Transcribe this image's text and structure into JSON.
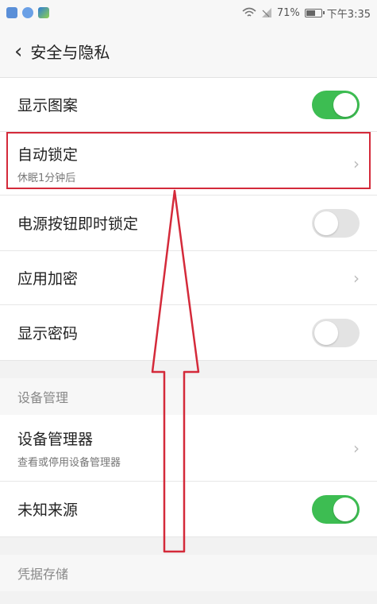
{
  "status": {
    "battery": "71%",
    "time": "下午3:35",
    "battery_level": 0.71
  },
  "header": {
    "back_icon": "chevron-left-icon",
    "title": "安全与隐私"
  },
  "items": [
    {
      "label": "显示图案",
      "control": "toggle",
      "on": true
    },
    {
      "label": "自动锁定",
      "subtitle": "休眠1分钟后",
      "control": "chevron"
    },
    {
      "label": "电源按钮即时锁定",
      "control": "toggle",
      "on": false
    },
    {
      "label": "应用加密",
      "control": "chevron"
    },
    {
      "label": "显示密码",
      "control": "toggle",
      "on": false
    }
  ],
  "section_device": {
    "title": "设备管理"
  },
  "device_items": [
    {
      "label": "设备管理器",
      "subtitle": "查看或停用设备管理器",
      "control": "chevron"
    },
    {
      "label": "未知来源",
      "control": "toggle",
      "on": true
    }
  ],
  "section_credentials": {
    "title": "凭据存储"
  },
  "colors": {
    "toggle_on": "#3dbd52",
    "toggle_off": "#e3e3e3",
    "annotation": "#d42a3a"
  }
}
